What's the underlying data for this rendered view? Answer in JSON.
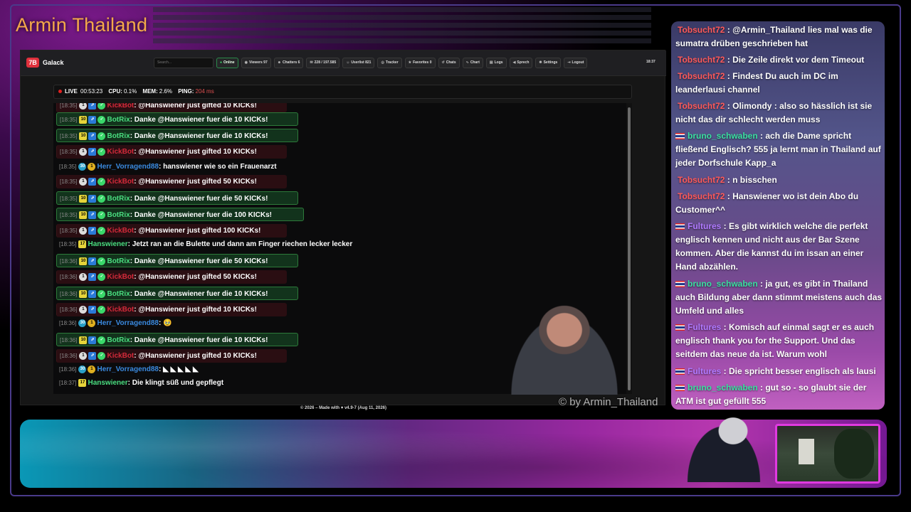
{
  "overlay_title": "Armin Thailand",
  "watermark": "© by Armin_Thailand",
  "app": {
    "logo": "7B",
    "brand": "Galack",
    "search_placeholder": "Search...",
    "clock": "18:37",
    "nav": [
      {
        "icon": "signal-icon",
        "label": "Online"
      },
      {
        "icon": "eye-icon",
        "label": "Viewers 97"
      },
      {
        "icon": "users-icon",
        "label": "Chatters 6"
      },
      {
        "icon": "chat-icon",
        "label": "228 / 197.585"
      },
      {
        "icon": "user-icon",
        "label": "Userlist 821"
      },
      {
        "icon": "target-icon",
        "label": "Tracker"
      },
      {
        "icon": "star-icon",
        "label": "Favorites 0"
      },
      {
        "icon": "history-icon",
        "label": "Chats"
      },
      {
        "icon": "chart-icon",
        "label": "Chart"
      },
      {
        "icon": "file-icon",
        "label": "Logs"
      },
      {
        "icon": "speaker-icon",
        "label": "Sprech"
      },
      {
        "icon": "gear-icon",
        "label": "Settings"
      },
      {
        "icon": "logout-icon",
        "label": "Logout"
      }
    ]
  },
  "status": {
    "live_label": "LIVE",
    "live_time": "00:53:23",
    "cpu_label": "CPU:",
    "cpu": "0.1%",
    "mem_label": "MEM:",
    "mem": "2.6%",
    "ping_label": "PING:",
    "ping": "204 ms"
  },
  "chat": [
    {
      "type": "kick",
      "time": "[18:35]",
      "name": "KickBot",
      "text": ": @Hanswiener just gifted 10 KICKs!"
    },
    {
      "type": "bot",
      "time": "[18:35]",
      "name": "BotRix",
      "text": ": Danke @Hanswiener fuer die 10 KICKs!"
    },
    {
      "type": "bot",
      "time": "[18:35]",
      "name": "BotRix",
      "text": ": Danke @Hanswiener fuer die 10 KICKs!"
    },
    {
      "type": "kick",
      "time": "[18:35]",
      "name": "KickBot",
      "text": ": @Hanswiener just gifted 10 KICKs!"
    },
    {
      "type": "herr",
      "time": "[18:35]",
      "name": "Herr_Vorragend88",
      "text": ": hanswiener wie so ein Frauenarzt"
    },
    {
      "type": "kick",
      "time": "[18:35]",
      "name": "KickBot",
      "text": ": @Hanswiener just gifted 50 KICKs!"
    },
    {
      "type": "bot",
      "time": "[18:35]",
      "name": "BotRix",
      "text": ": Danke @Hanswiener fuer die 50 KICKs!"
    },
    {
      "type": "bot",
      "time": "[18:35]",
      "name": "BotRix",
      "text": ": Danke @Hanswiener fuer die 100 KICKs!"
    },
    {
      "type": "kick",
      "time": "[18:35]",
      "name": "KickBot",
      "text": ": @Hanswiener just gifted 100 KICKs!"
    },
    {
      "type": "hans",
      "time": "[18:35]",
      "name": "Hanswiener",
      "text": ": Jetzt ran an die Bulette und dann am Finger riechen lecker lecker"
    },
    {
      "type": "bot",
      "time": "[18:36]",
      "name": "BotRix",
      "text": ": Danke @Hanswiener fuer die 50 KICKs!"
    },
    {
      "type": "kick",
      "time": "[18:36]",
      "name": "KickBot",
      "text": ": @Hanswiener just gifted 50 KICKs!"
    },
    {
      "type": "bot",
      "time": "[18:36]",
      "name": "BotRix",
      "text": ": Danke @Hanswiener fuer die 10 KICKs!"
    },
    {
      "type": "kick",
      "time": "[18:36]",
      "name": "KickBot",
      "text": ": @Hanswiener just gifted 10 KICKs!"
    },
    {
      "type": "herr",
      "time": "[18:36]",
      "name": "Herr_Vorragend88",
      "text": ": 🥹"
    },
    {
      "type": "bot",
      "time": "[18:36]",
      "name": "BotRix",
      "text": ": Danke @Hanswiener fuer die 10 KICKs!"
    },
    {
      "type": "kick",
      "time": "[18:36]",
      "name": "KickBot",
      "text": ": @Hanswiener just gifted 10 KICKs!"
    },
    {
      "type": "herr",
      "time": "[18:36]",
      "name": "Herr_Vorragend88",
      "text": ": ◣ ◣ ◣ ◣ ◣"
    },
    {
      "type": "hans",
      "time": "[18:37]",
      "name": "Hanswiener",
      "text": ": Die klingt süß und gepflegt"
    }
  ],
  "footer": "© 2026 – Made with ♥ v4.9-7 (Aug 11, 2026)",
  "overlay_chat": [
    {
      "user": "Tobsucht72",
      "cls": "tob",
      "flag": false,
      "text": " : @Armin_Thailand lies mal was die sumatra drüben geschrieben hat"
    },
    {
      "user": "Tobsucht72",
      "cls": "tob",
      "flag": false,
      "text": " : Die Zeile direkt vor dem Timeout"
    },
    {
      "user": "Tobsucht72",
      "cls": "tob",
      "flag": false,
      "text": " : Findest Du auch im DC im leanderlausi channel"
    },
    {
      "user": "Tobsucht72",
      "cls": "tob",
      "flag": false,
      "text": " : Olimondy : also so hässlich ist sie nicht das dir schlecht werden muss"
    },
    {
      "user": "bruno_schwaben",
      "cls": "bru",
      "flag": true,
      "text": " : ach die Dame spricht fließend Englisch? 555 ja lernt man in Thailand auf jeder Dorfschule Kapp_a"
    },
    {
      "user": "Tobsucht72",
      "cls": "tob",
      "flag": false,
      "text": " : n bisschen"
    },
    {
      "user": "Tobsucht72",
      "cls": "tob",
      "flag": false,
      "text": " : Hanswiener wo ist dein Abo du Customer^^"
    },
    {
      "user": "Fultures",
      "cls": "ful",
      "flag": true,
      "text": " : Es gibt wirklich welche die perfekt englisch kennen und nicht aus der Bar Szene kommen. Aber die kannst du im issan an einer Hand abzählen."
    },
    {
      "user": "bruno_schwaben",
      "cls": "bru",
      "flag": true,
      "text": " : ja gut, es gibt in Thailand auch Bildung aber dann stimmt meistens auch das Umfeld und alles"
    },
    {
      "user": "Fultures",
      "cls": "ful",
      "flag": true,
      "text": " : Komisch auf einmal sagt er es auch englisch thank you for the Support. Und das seitdem das neue da ist. Warum wohl"
    },
    {
      "user": "Fultures",
      "cls": "ful",
      "flag": true,
      "text": " : Die spricht besser englisch als lausi"
    },
    {
      "user": "bruno_schwaben",
      "cls": "bru",
      "flag": true,
      "text": " : gut so - so glaubt sie der ATM ist gut gefüllt 555"
    }
  ]
}
